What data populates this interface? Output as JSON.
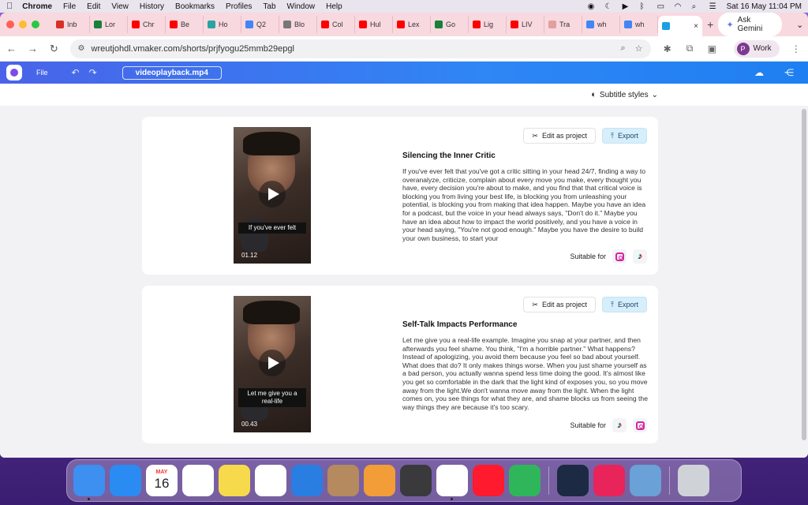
{
  "menubar": {
    "apple": "",
    "app": "Chrome",
    "items": [
      "File",
      "Edit",
      "View",
      "History",
      "Bookmarks",
      "Profiles",
      "Tab",
      "Window",
      "Help"
    ],
    "clock": "Sat 16 May  11:04 PM"
  },
  "tabs": [
    {
      "label": "Inb",
      "color": "#d93025"
    },
    {
      "label": "Lor",
      "color": "#188038"
    },
    {
      "label": "Chr",
      "color": "#ff0000"
    },
    {
      "label": "Be",
      "color": "#ff0000"
    },
    {
      "label": "Ho",
      "color": "#2aa3a3"
    },
    {
      "label": "Q2",
      "color": "#4285f4"
    },
    {
      "label": "Blo",
      "color": "#777777"
    },
    {
      "label": "Col",
      "color": "#ff0000"
    },
    {
      "label": "Hul",
      "color": "#ff0000"
    },
    {
      "label": "Lex",
      "color": "#ff0000"
    },
    {
      "label": "Go",
      "color": "#188038"
    },
    {
      "label": "Lig",
      "color": "#ff0000"
    },
    {
      "label": "LIV",
      "color": "#ff0000"
    },
    {
      "label": "Tra",
      "color": "#e0a0a0"
    },
    {
      "label": "wh",
      "color": "#4285f4"
    },
    {
      "label": "wh",
      "color": "#4285f4"
    }
  ],
  "active_tab": {
    "label": "",
    "color": "#1ba1e2"
  },
  "ask_gemini": "Ask Gemini",
  "url": "wreutjohdl.vmaker.com/shorts/prjfyogu25mmb29epgl",
  "profile": {
    "initial": "P",
    "label": "Work"
  },
  "app": {
    "file_menu": "File",
    "filename": "videoplayback.mp4",
    "subtitle_styles": "Subtitle styles"
  },
  "buttons": {
    "edit": "Edit as project",
    "export": "Export",
    "suitable": "Suitable for"
  },
  "shorts": [
    {
      "title": "Silencing the Inner Critic",
      "caption": "If you've ever felt",
      "duration": "01.12",
      "body": "If you've ever felt that you've got a critic sitting in your head 24/7, finding a way to overanalyze, criticize, complain about every move you make, every thought you have, every decision you're about to make, and you find that that critical voice is blocking you from living your best life, is blocking you from unleashing your potential, is blocking you from making that idea happen. Maybe you have an idea for a podcast, but the voice in your head always says, \"Don't do it.\" Maybe you have an idea about how to impact the world positively, and you have a voice in your head saying, \"You're not good enough.\" Maybe you have the desire to build your own business, to start your",
      "platforms": [
        "instagram",
        "tiktok"
      ]
    },
    {
      "title": "Self-Talk Impacts Performance",
      "caption": "Let me give you a real-life",
      "duration": "00.43",
      "body": "Let me give you a real-life example. Imagine you snap at your partner, and then afterwards you feel shame. You think, \"I'm a horrible partner.\" What happens? Instead of apologizing, you avoid them because you feel so bad about yourself. What does that do? It only makes things worse. When you just shame yourself as a bad person, you actually wanna spend less time doing the good. It's almost like you get so comfortable in the dark that the light kind of exposes you, so you move away from the light.We don't wanna move away from the light. When the light comes on, you see things for what they are, and shame blocks us from seeing the way things they are because it's too scary.",
      "platforms": [
        "tiktok",
        "instagram"
      ]
    }
  ],
  "dock": [
    {
      "name": "finder",
      "color": "#3d8ff0"
    },
    {
      "name": "safari",
      "color": "#2a8bf2"
    },
    {
      "name": "calendar",
      "month": "MAY",
      "day": "16"
    },
    {
      "name": "reminders",
      "color": "#ffffff"
    },
    {
      "name": "notes",
      "color": "#f7d94c"
    },
    {
      "name": "freeform",
      "color": "#ffffff"
    },
    {
      "name": "keynote",
      "color": "#2a7de1"
    },
    {
      "name": "contacts",
      "color": "#b48a5e"
    },
    {
      "name": "pages",
      "color": "#f29d38"
    },
    {
      "name": "calculator",
      "color": "#3a3a3c"
    },
    {
      "name": "chrome",
      "color": "#ffffff"
    },
    {
      "name": "opera",
      "color": "#ff1b2d"
    },
    {
      "name": "numbers",
      "color": "#2fb65a"
    },
    {
      "name": "quicktime",
      "color": "#1c2a44"
    },
    {
      "name": "creative-cloud",
      "color": "#e8245b"
    },
    {
      "name": "preview",
      "color": "#6aa1d6"
    },
    {
      "name": "trash",
      "color": "#cfd3d8"
    }
  ]
}
